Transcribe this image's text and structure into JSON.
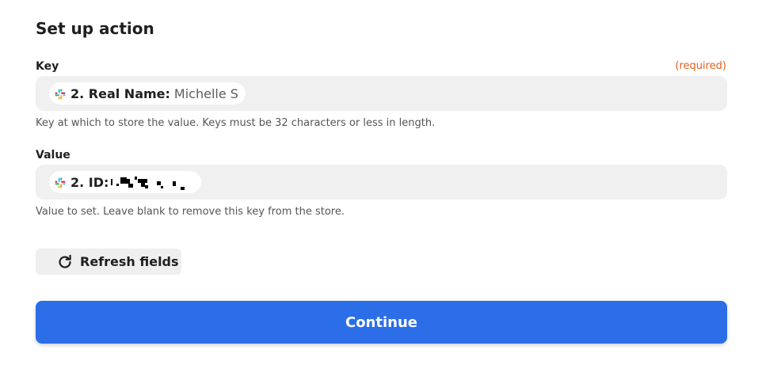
{
  "section": {
    "title": "Set up action"
  },
  "key_field": {
    "label": "Key",
    "required_text": "(required)",
    "pill_label": "2. Real Name:",
    "pill_value": "Michelle S",
    "pill_icon": "slack-icon",
    "help_text": "Key at which to store the value. Keys must be 32 characters or less in length."
  },
  "value_field": {
    "label": "Value",
    "pill_label": "2. ID:",
    "pill_icon": "slack-icon",
    "help_text": "Value to set. Leave blank to remove this key from the store."
  },
  "refresh": {
    "label": "Refresh fields",
    "icon": "refresh-icon"
  },
  "continue": {
    "label": "Continue"
  },
  "colors": {
    "required": "#e0611a",
    "primary": "#2b6ee8",
    "input_bg": "#f0f0f0"
  }
}
